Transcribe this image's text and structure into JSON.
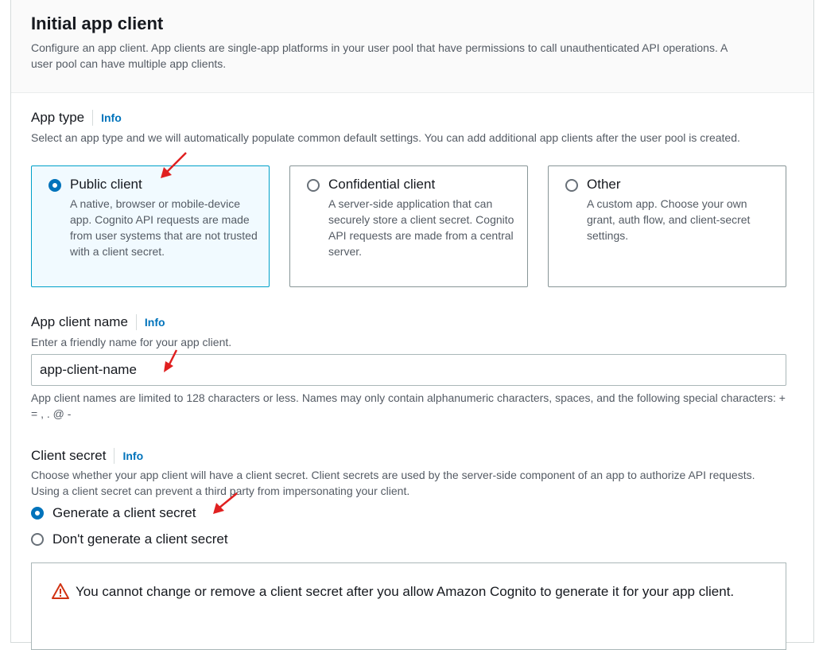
{
  "section": {
    "title": "Initial app client",
    "description": "Configure an app client. App clients are single-app platforms in your user pool that have permissions to call unauthenticated API operations. A user pool can have multiple app clients."
  },
  "app_type": {
    "label": "App type",
    "info": "Info",
    "description": "Select an app type and we will automatically populate common default settings. You can add additional app clients after the user pool is created.",
    "options": [
      {
        "title": "Public client",
        "description": "A native, browser or mobile-device app. Cognito API requests are made from user systems that are not trusted with a client secret.",
        "selected": true
      },
      {
        "title": "Confidential client",
        "description": "A server-side application that can securely store a client secret. Cognito API requests are made from a central server.",
        "selected": false
      },
      {
        "title": "Other",
        "description": "A custom app. Choose your own grant, auth flow, and client-secret settings.",
        "selected": false
      }
    ]
  },
  "app_client_name": {
    "label": "App client name",
    "info": "Info",
    "description": "Enter a friendly name for your app client.",
    "value": "app-client-name",
    "constraint": "App client names are limited to 128 characters or less. Names may only contain alphanumeric characters, spaces, and the following special characters: + = , . @ -"
  },
  "client_secret": {
    "label": "Client secret",
    "info": "Info",
    "description": "Choose whether your app client will have a client secret. Client secrets are used by the server-side component of an app to authorize API requests. Using a client secret can prevent a third party from impersonating your client.",
    "options": [
      {
        "label": "Generate a client secret",
        "selected": true
      },
      {
        "label": "Don't generate a client secret",
        "selected": false
      }
    ],
    "warning": "You cannot change or remove a client secret after you allow Amazon Cognito to generate it for your app client."
  },
  "colors": {
    "accent": "#0073bb",
    "selected_border": "#00a1c9",
    "selected_bg": "#f1faff",
    "warning": "#d13212",
    "annotation_arrow": "#e02020"
  },
  "icons": {
    "warning": "warning-triangle-icon",
    "annotation": "red-arrow-annotation"
  }
}
